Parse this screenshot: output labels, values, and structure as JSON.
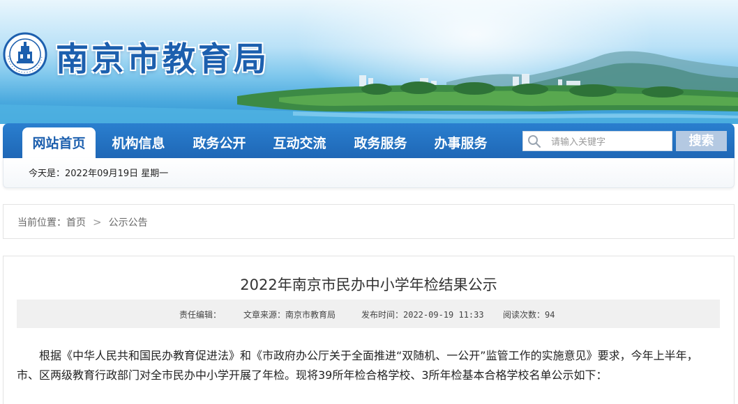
{
  "header": {
    "site_title": "南京市教育局",
    "logo_text": "南京市教育局",
    "logo_ring_text": "NANJING EDUCATION",
    "brand_color": "#1c5fae"
  },
  "nav": {
    "items": [
      {
        "label": "网站首页",
        "active": true
      },
      {
        "label": "机构信息",
        "active": false
      },
      {
        "label": "政务公开",
        "active": false
      },
      {
        "label": "互动交流",
        "active": false
      },
      {
        "label": "政务服务",
        "active": false
      },
      {
        "label": "办事服务",
        "active": false
      }
    ],
    "search_placeholder": "请输入关键字",
    "search_button": "搜索",
    "bar_color": "#1f67b6"
  },
  "datebar": {
    "text": "今天是：2022年09月19日 星期一"
  },
  "breadcrumb": {
    "prefix": "当前位置：",
    "items": [
      "首页",
      "公示公告"
    ],
    "separator": ">"
  },
  "article": {
    "title": "2022年南京市民办中小学年检结果公示",
    "meta": {
      "editor": "责任编辑：",
      "source": "文章来源：南京市教育局",
      "published": "发布时间：2022-09-19 11:33",
      "views": "阅读次数：94"
    },
    "body": "根据《中华人民共和国民办教育促进法》和《市政府办公厅关于全面推进“双随机、一公开”监管工作的实施意见》要求，今年上半年，市、区两级教育行政部门对全市民办中小学开展了年检。现将39所年检合格学校、3所年检基本合格学校名单公示如下："
  }
}
